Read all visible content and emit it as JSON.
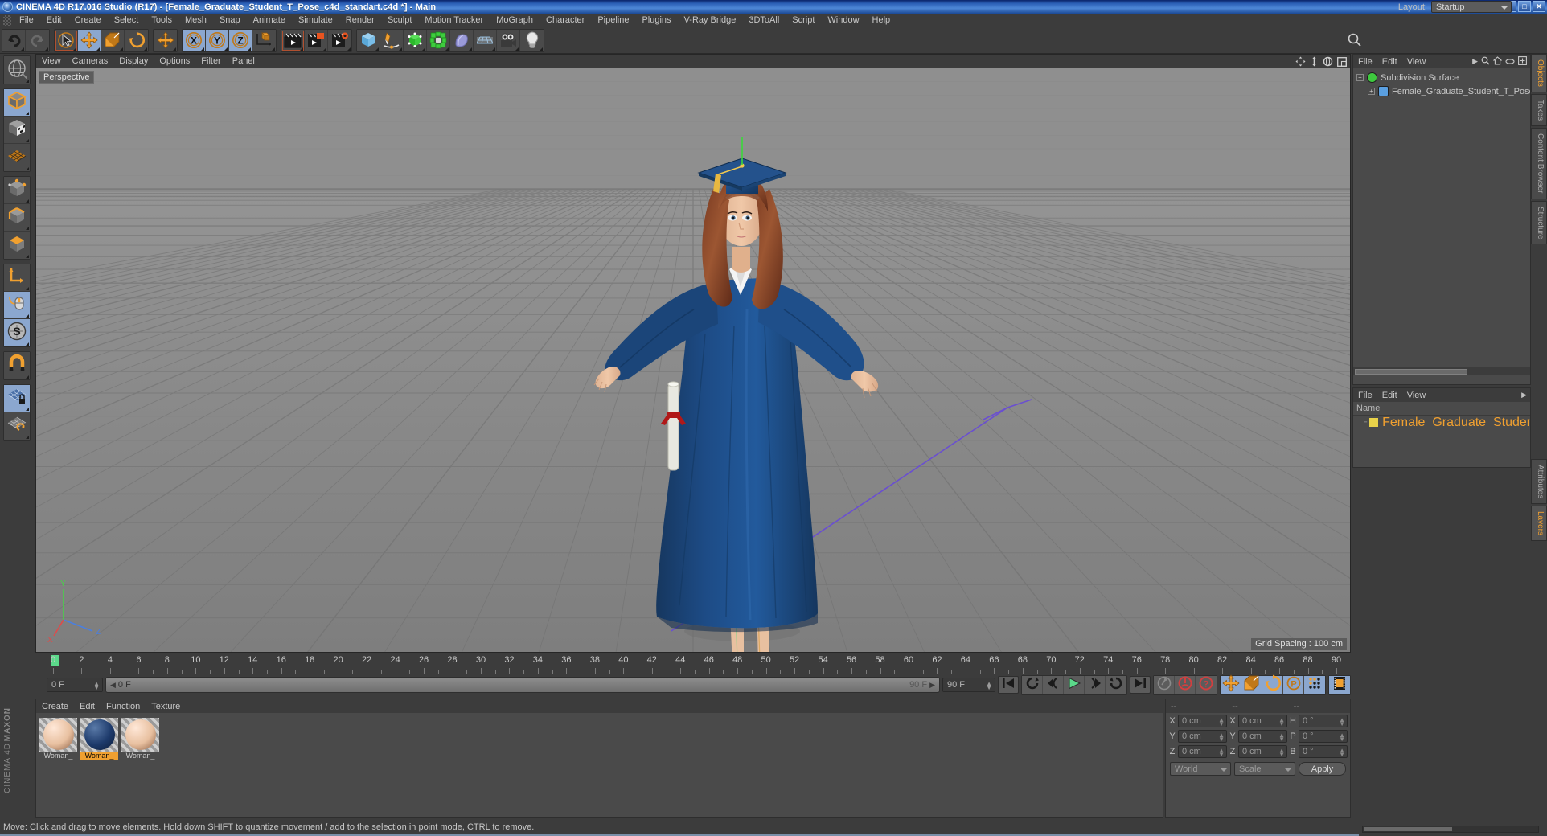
{
  "titlebar": {
    "text": "CINEMA 4D R17.016 Studio (R17) - [Female_Graduate_Student_T_Pose_c4d_standart.c4d *] - Main",
    "minimize": "_",
    "maximize": "□",
    "close": "✕"
  },
  "menubar": {
    "items": [
      "File",
      "Edit",
      "Create",
      "Select",
      "Tools",
      "Mesh",
      "Snap",
      "Animate",
      "Simulate",
      "Render",
      "Sculpt",
      "Motion Tracker",
      "MoGraph",
      "Character",
      "Pipeline",
      "Plugins",
      "V-Ray Bridge",
      "3DToAll",
      "Script",
      "Window",
      "Help"
    ]
  },
  "layout": {
    "label": "Layout:",
    "value": "Startup"
  },
  "toolbar": {
    "groups": [
      {
        "name": "history",
        "buttons": [
          {
            "name": "undo-button",
            "icon": "undo-icon",
            "state": "normal"
          },
          {
            "name": "redo-button",
            "icon": "redo-icon",
            "state": "disabled"
          }
        ]
      },
      {
        "name": "transform",
        "buttons": [
          {
            "name": "select-tool-button",
            "icon": "cursor-select-icon",
            "state": "framed"
          },
          {
            "name": "move-tool-button",
            "icon": "move-arrows-icon",
            "state": "selected"
          },
          {
            "name": "scale-tool-button",
            "icon": "scale-box-icon",
            "state": "normal"
          },
          {
            "name": "rotate-tool-button",
            "icon": "rotate-circle-icon",
            "state": "normal"
          }
        ]
      },
      {
        "name": "move-single",
        "buttons": [
          {
            "name": "move-axis-button",
            "icon": "move-arrows-icon",
            "state": "normal"
          }
        ]
      },
      {
        "name": "axis-locks",
        "buttons": [
          {
            "name": "lock-x-button",
            "icon": "axis-x-icon",
            "label": "X",
            "state": "selected"
          },
          {
            "name": "lock-y-button",
            "icon": "axis-y-icon",
            "label": "Y",
            "state": "selected"
          },
          {
            "name": "lock-z-button",
            "icon": "axis-z-icon",
            "label": "Z",
            "state": "selected"
          },
          {
            "name": "world-object-coords-button",
            "icon": "world-cube-icon",
            "state": "normal"
          }
        ]
      },
      {
        "name": "render",
        "buttons": [
          {
            "name": "render-view-button",
            "icon": "clapperboard-icon",
            "state": "framed"
          },
          {
            "name": "render-to-picture-viewer-button",
            "icon": "clapperboard-picture-icon",
            "state": "normal"
          },
          {
            "name": "render-settings-button",
            "icon": "clapperboard-gear-icon",
            "state": "normal"
          }
        ]
      },
      {
        "name": "create",
        "buttons": [
          {
            "name": "add-cube-button",
            "icon": "cube-icon",
            "state": "normal"
          },
          {
            "name": "add-spline-button",
            "icon": "pen-spline-icon",
            "state": "normal"
          },
          {
            "name": "add-generator-button",
            "icon": "green-generator-icon",
            "state": "normal"
          },
          {
            "name": "add-deformer-button",
            "icon": "green-deformer-icon",
            "state": "normal"
          },
          {
            "name": "add-scene-object-button",
            "icon": "environment-icon",
            "state": "normal"
          },
          {
            "name": "add-floor-button",
            "icon": "floor-grid-icon",
            "state": "normal"
          },
          {
            "name": "add-camera-button",
            "icon": "camera-icon",
            "state": "normal"
          },
          {
            "name": "add-light-button",
            "icon": "lightbulb-icon",
            "state": "normal"
          }
        ]
      }
    ]
  },
  "lefttools": {
    "groups": [
      {
        "buttons": [
          {
            "name": "make-editable-button",
            "icon": "globe-editable-icon",
            "state": "normal"
          }
        ]
      },
      {
        "buttons": [
          {
            "name": "model-mode-button",
            "icon": "model-cube-icon",
            "state": "selected"
          },
          {
            "name": "texture-mode-button",
            "icon": "texture-cube-icon",
            "state": "normal"
          },
          {
            "name": "uv-mesh-button",
            "icon": "uv-grid-icon",
            "state": "normal"
          }
        ]
      },
      {
        "buttons": [
          {
            "name": "point-mode-button",
            "icon": "point-cube-icon",
            "state": "normal"
          },
          {
            "name": "edge-mode-button",
            "icon": "edge-cube-icon",
            "state": "normal"
          },
          {
            "name": "polygon-mode-button",
            "icon": "polygon-cube-icon",
            "state": "normal"
          }
        ]
      },
      {
        "buttons": [
          {
            "name": "axis-mode-button",
            "icon": "axis-l-icon",
            "state": "normal"
          },
          {
            "name": "viewport-solo-button",
            "icon": "mouse-cursor-icon",
            "state": "selected"
          },
          {
            "name": "soft-selection-button",
            "icon": "s-circle-icon",
            "state": "selected"
          }
        ]
      },
      {
        "buttons": [
          {
            "name": "snap-magnet-button",
            "icon": "magnet-icon",
            "state": "normal"
          }
        ]
      },
      {
        "buttons": [
          {
            "name": "workplane-lock-button",
            "icon": "grid-lock-icon",
            "state": "selected"
          },
          {
            "name": "workplane-rotate-button",
            "icon": "grid-rotate-icon",
            "state": "normal"
          }
        ]
      }
    ],
    "branding_top": "MAXON",
    "branding_bottom": "CINEMA 4D"
  },
  "viewport": {
    "menu": [
      "View",
      "Cameras",
      "Display",
      "Options",
      "Filter",
      "Panel"
    ],
    "label": "Perspective",
    "grid_spacing": "Grid Spacing : 100 cm",
    "nav_icons": [
      "pan-icon",
      "dolly-icon",
      "orbit-icon",
      "maximize-view-icon"
    ],
    "axis_gizmo": {
      "x": "X",
      "y": "Y",
      "z": "Z"
    }
  },
  "object_manager": {
    "menu": [
      "File",
      "Edit",
      "View"
    ],
    "icons": [
      "more-arrow-icon",
      "search-icon",
      "home-icon",
      "ellipse-icon",
      "plus-icon"
    ],
    "tree": [
      {
        "name": "Subdivision Surface",
        "indent": 0,
        "icon_color": "#3ec93e"
      },
      {
        "name": "Female_Graduate_Student_T_Pose",
        "indent": 1,
        "icon_color": "#5a9fe0"
      }
    ]
  },
  "layer_manager": {
    "menu": [
      "File",
      "Edit",
      "View"
    ],
    "column_header": "Name",
    "rows": [
      {
        "name": "Female_Graduate_Student_T_Pose",
        "swatch": "#e8d24a",
        "color": "#f0a030"
      }
    ]
  },
  "right_tabs": {
    "top": [
      {
        "label": "Objects",
        "active": true
      },
      {
        "label": "Takes",
        "active": false
      },
      {
        "label": "Content Browser",
        "active": false
      },
      {
        "label": "Structure",
        "active": false
      }
    ],
    "bottom": [
      {
        "label": "Attributes",
        "active": false
      },
      {
        "label": "Layers",
        "active": true
      }
    ]
  },
  "timeline": {
    "ticks": [
      0,
      2,
      4,
      6,
      8,
      10,
      12,
      14,
      16,
      18,
      20,
      22,
      24,
      26,
      28,
      30,
      32,
      34,
      36,
      38,
      40,
      42,
      44,
      46,
      48,
      50,
      52,
      54,
      56,
      58,
      60,
      62,
      64,
      66,
      68,
      70,
      72,
      74,
      76,
      78,
      80,
      82,
      84,
      86,
      88,
      90
    ],
    "range_start": 0,
    "range_end": 90,
    "current_frame_field": "0 F",
    "scrub_value": "0 F",
    "end_frame_display": "90 F",
    "end_frame_field": "90 F",
    "playhead_frame": 0,
    "transport": [
      {
        "name": "go-to-start-button",
        "icon": "skip-start-icon"
      },
      {
        "name": "previous-key-button",
        "icon": "rewind-key-icon"
      },
      {
        "name": "step-back-button",
        "icon": "step-back-icon"
      },
      {
        "name": "play-button",
        "icon": "play-icon"
      },
      {
        "name": "step-forward-button",
        "icon": "step-forward-icon"
      },
      {
        "name": "next-key-button",
        "icon": "forward-key-icon"
      },
      {
        "name": "go-to-end-button",
        "icon": "skip-end-icon"
      }
    ],
    "record_group": [
      {
        "name": "autokey-button",
        "icon": "key-icon"
      },
      {
        "name": "record-button",
        "icon": "record-red-icon"
      },
      {
        "name": "keyframe-selection-button",
        "icon": "question-red-icon"
      }
    ],
    "param_group": [
      {
        "name": "record-position-button",
        "icon": "move-arrows-icon"
      },
      {
        "name": "record-scale-button",
        "icon": "scale-box-icon"
      },
      {
        "name": "record-rotation-button",
        "icon": "rotate-circle-icon"
      },
      {
        "name": "record-pla-button",
        "icon": "p-circle-icon"
      },
      {
        "name": "record-points-button",
        "icon": "dots-grid-icon"
      }
    ],
    "extra_group": [
      {
        "name": "timeline-filmstrip-button",
        "icon": "filmstrip-icon"
      }
    ]
  },
  "material_manager": {
    "menu": [
      "Create",
      "Edit",
      "Function",
      "Texture"
    ],
    "materials": [
      {
        "name": "Woman_",
        "color": "#e8c0a0",
        "selected": false
      },
      {
        "name": "Woman_",
        "color": "#1d3a6b",
        "selected": true
      },
      {
        "name": "Woman_",
        "color": "#e8c0a0",
        "selected": false
      }
    ]
  },
  "coordinates": {
    "header": [
      "--",
      "--",
      "--"
    ],
    "rows": [
      {
        "axis1": "X",
        "value1": "0 cm",
        "axis2": "X",
        "value2": "0 cm",
        "axis3": "H",
        "value3": "0 °"
      },
      {
        "axis1": "Y",
        "value1": "0 cm",
        "axis2": "Y",
        "value2": "0 cm",
        "axis3": "P",
        "value3": "0 °"
      },
      {
        "axis1": "Z",
        "value1": "0 cm",
        "axis2": "Z",
        "value2": "0 cm",
        "axis3": "B",
        "value3": "0 °"
      }
    ],
    "space_select": "World",
    "mode_select": "Scale",
    "apply_label": "Apply"
  },
  "statusbar": {
    "text": "Move: Click and drag to move elements. Hold down SHIFT to quantize movement / add to the selection in point mode, CTRL to remove."
  },
  "scene": {
    "gown_color": "#1d4b85",
    "gown_shadow": "#14355f",
    "skin_color": "#f0c8a8",
    "hair_color": "#7a3b22",
    "hair_highlight": "#9c5632",
    "shoe_color": "#141414",
    "diploma_color": "#e8e8e0",
    "ribbon_color": "#b01818",
    "floor_color": "#8a8a8a",
    "grid_line_color": "#6e6e6e"
  }
}
